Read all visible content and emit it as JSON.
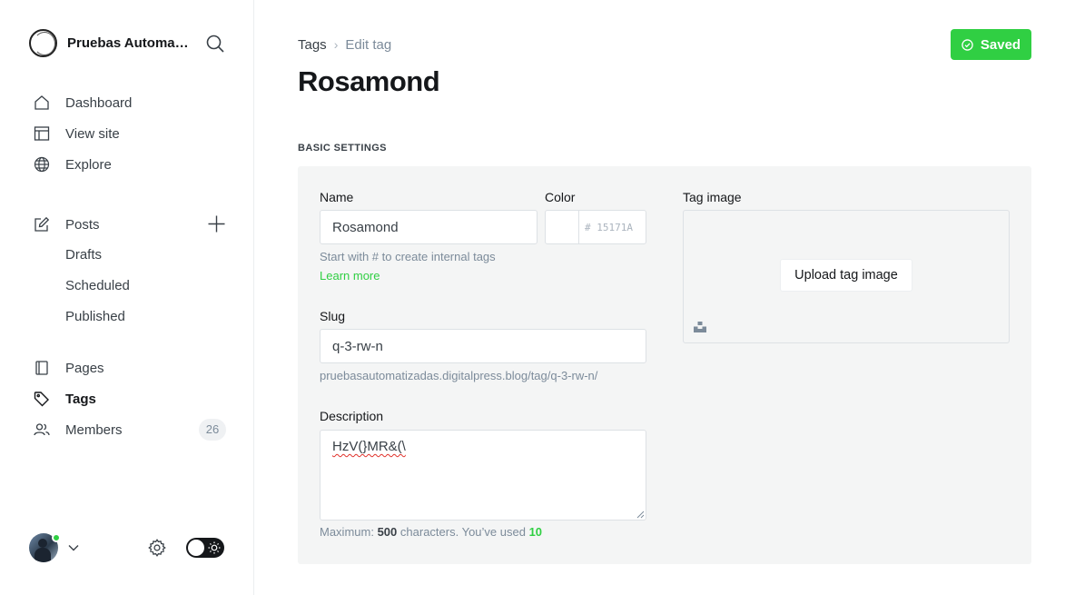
{
  "sidebar": {
    "site_name": "Pruebas Automatizadas",
    "nav": {
      "dashboard": "Dashboard",
      "view_site": "View site",
      "explore": "Explore",
      "posts": "Posts",
      "drafts": "Drafts",
      "scheduled": "Scheduled",
      "published": "Published",
      "pages": "Pages",
      "tags": "Tags",
      "members": "Members",
      "members_count": "26"
    }
  },
  "header": {
    "breadcrumb_parent": "Tags",
    "breadcrumb_current": "Edit tag",
    "title": "Rosamond",
    "saved_label": "Saved"
  },
  "form": {
    "section_label": "BASIC SETTINGS",
    "name_label": "Name",
    "name_value": "Rosamond",
    "name_hint": "Start with # to create internal tags",
    "learn_more": "Learn more",
    "color_label": "Color",
    "color_placeholder": "# 15171A",
    "slug_label": "Slug",
    "slug_value": "q-3-rw-n",
    "slug_url": "pruebasautomatizadas.digitalpress.blog/tag/q-3-rw-n/",
    "description_label": "Description",
    "description_value": "HzV(}MR&(\\",
    "counter_prefix": "Maximum:",
    "counter_max": "500",
    "counter_middle": "characters. You’ve used",
    "counter_used": "10",
    "tag_image_label": "Tag image",
    "upload_label": "Upload tag image"
  },
  "colors": {
    "accent_green": "#30cf43",
    "text_dark": "#15171a",
    "panel_bg": "#f4f5f5"
  }
}
